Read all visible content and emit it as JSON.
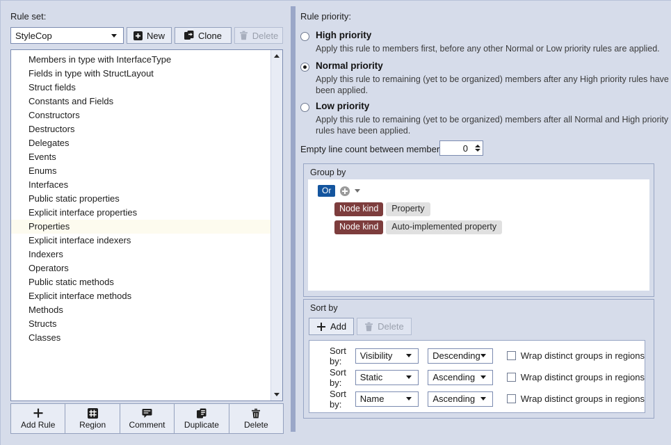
{
  "left": {
    "ruleset_label": "Rule set:",
    "ruleset_value": "StyleCop",
    "buttons": [
      {
        "label": "New",
        "icon": "plus-square-icon",
        "disabled": false
      },
      {
        "label": "Clone",
        "icon": "clone-icon",
        "disabled": false
      },
      {
        "label": "Delete",
        "icon": "trash-icon",
        "disabled": true
      }
    ],
    "rules": [
      {
        "label": "Members in type with InterfaceType",
        "selected": false
      },
      {
        "label": "Fields in type with StructLayout",
        "selected": false
      },
      {
        "label": "Struct fields",
        "selected": false
      },
      {
        "label": "Constants and Fields",
        "selected": false
      },
      {
        "label": "Constructors",
        "selected": false
      },
      {
        "label": "Destructors",
        "selected": false
      },
      {
        "label": "Delegates",
        "selected": false
      },
      {
        "label": "Events",
        "selected": false
      },
      {
        "label": "Enums",
        "selected": false
      },
      {
        "label": "Interfaces",
        "selected": false
      },
      {
        "label": "Public static properties",
        "selected": false
      },
      {
        "label": "Explicit interface properties",
        "selected": false
      },
      {
        "label": "Properties",
        "selected": true
      },
      {
        "label": "Explicit interface indexers",
        "selected": false
      },
      {
        "label": "Indexers",
        "selected": false
      },
      {
        "label": "Operators",
        "selected": false
      },
      {
        "label": "Public static methods",
        "selected": false
      },
      {
        "label": "Explicit interface methods",
        "selected": false
      },
      {
        "label": "Methods",
        "selected": false
      },
      {
        "label": "Structs",
        "selected": false
      },
      {
        "label": "Classes",
        "selected": false
      }
    ],
    "toolbar": [
      {
        "label": "Add Rule",
        "icon": "plus-icon"
      },
      {
        "label": "Region",
        "icon": "hash-region-icon"
      },
      {
        "label": "Comment",
        "icon": "comment-icon"
      },
      {
        "label": "Duplicate",
        "icon": "duplicate-icon"
      },
      {
        "label": "Delete",
        "icon": "trash-icon"
      }
    ]
  },
  "right": {
    "priority_label": "Rule priority:",
    "priorities": [
      {
        "title": "High priority",
        "selected": false,
        "description": "Apply this rule to members first, before any other Normal or Low priority rules are applied."
      },
      {
        "title": "Normal priority",
        "selected": true,
        "description": "Apply this rule to remaining (yet to be organized) members after any High priority rules have been applied."
      },
      {
        "title": "Low priority",
        "selected": false,
        "description": "Apply this rule to remaining (yet to be organized) members after all Normal and High priority rules have been applied."
      }
    ],
    "empty_line_label": "Empty line count between members:",
    "empty_line_value": "0",
    "group_by": {
      "title": "Group by",
      "operator": "Or",
      "conditions": [
        {
          "key": "Node kind",
          "value": "Property"
        },
        {
          "key": "Node kind",
          "value": "Auto-implemented property"
        }
      ]
    },
    "sort_by": {
      "title": "Sort by",
      "add_label": "Add",
      "delete_label": "Delete",
      "delete_disabled": true,
      "rows": [
        {
          "label": "Sort by:",
          "field": "Visibility",
          "direction": "Descending",
          "wrap_label": "Wrap distinct groups in regions",
          "wrap_checked": false
        },
        {
          "label": "Sort by:",
          "field": "Static",
          "direction": "Ascending",
          "wrap_label": "Wrap distinct groups in regions",
          "wrap_checked": false
        },
        {
          "label": "Sort by:",
          "field": "Name",
          "direction": "Ascending",
          "wrap_label": "Wrap distinct groups in regions",
          "wrap_checked": false
        }
      ]
    }
  },
  "colors": {
    "window_bg": "#d6dcea",
    "accent_blue": "#14559e",
    "tag_key_bg": "#7d3d3d",
    "tag_value_bg": "#e0e0e0",
    "selection_bg": "#fdfbef"
  }
}
